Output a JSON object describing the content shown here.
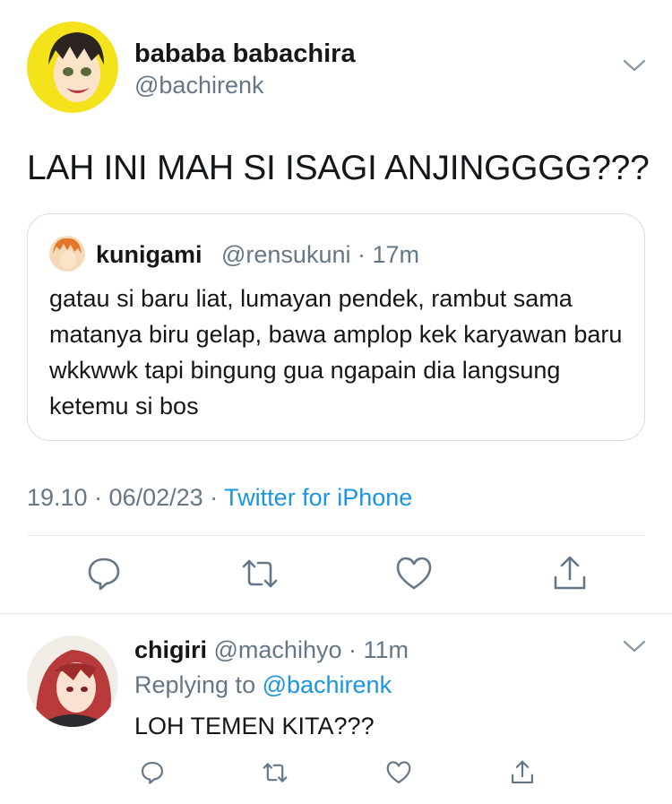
{
  "tweet": {
    "display_name": "bababa babachira",
    "handle": "@bachirenk",
    "text": "LAH INI MAH SI ISAGI ANJINGGGG???",
    "quote": {
      "name": "kunigami",
      "meta": "@rensukuni · 17m",
      "text": "gatau si baru liat, lumayan pendek, rambut sama matanya biru gelap, bawa amplop kek karyawan baru wkkwwk tapi bingung gua ngapain dia langsung ketemu si bos"
    },
    "timestamp": "19.10 · 06/02/23 · ",
    "source": "Twitter for iPhone",
    "actions": {
      "reply_icon": "speech-bubble-icon",
      "retweet_icon": "retweet-icon",
      "like_icon": "heart-icon",
      "share_icon": "share-icon"
    }
  },
  "reply": {
    "name": "chigiri",
    "meta": " @machihyo · 11m",
    "replying_prefix": "Replying to ",
    "replying_handle": "@bachirenk",
    "text": "LOH TEMEN KITA???"
  },
  "colors": {
    "text": "#14171a",
    "secondary": "#657786",
    "link": "#1b95e0",
    "border": "#e1e8ed"
  }
}
